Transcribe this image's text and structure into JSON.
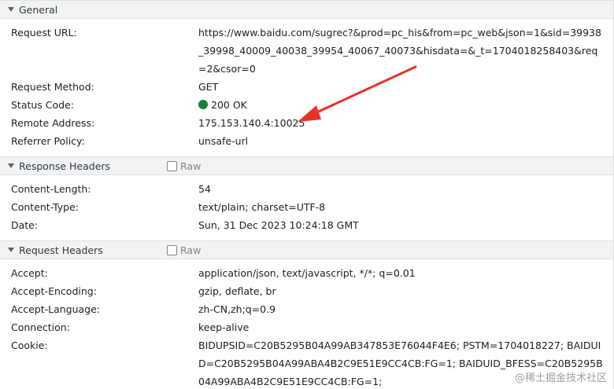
{
  "general": {
    "title": "General",
    "rows": [
      {
        "key": "Request URL:",
        "value": "https://www.baidu.com/sugrec?&prod=pc_his&from=pc_web&json=1&sid=39938_39998_40009_40038_39954_40067_40073&hisdata=&_t=1704018258403&req=2&csor=0"
      },
      {
        "key": "Request Method:",
        "value": "GET"
      },
      {
        "key": "Status Code:",
        "value": "200 OK",
        "status_color": "#188038"
      },
      {
        "key": "Remote Address:",
        "value": "175.153.140.4:10025"
      },
      {
        "key": "Referrer Policy:",
        "value": "unsafe-url"
      }
    ]
  },
  "response_headers": {
    "title": "Response Headers",
    "raw_label": "Raw",
    "rows": [
      {
        "key": "Content-Length:",
        "value": "54"
      },
      {
        "key": "Content-Type:",
        "value": "text/plain; charset=UTF-8"
      },
      {
        "key": "Date:",
        "value": "Sun, 31 Dec 2023 10:24:18 GMT"
      }
    ]
  },
  "request_headers": {
    "title": "Request Headers",
    "raw_label": "Raw",
    "rows": [
      {
        "key": "Accept:",
        "value": "application/json, text/javascript, */*; q=0.01"
      },
      {
        "key": "Accept-Encoding:",
        "value": "gzip, deflate, br"
      },
      {
        "key": "Accept-Language:",
        "value": "zh-CN,zh;q=0.9"
      },
      {
        "key": "Connection:",
        "value": "keep-alive"
      },
      {
        "key": "Cookie:",
        "value": "BIDUPSID=C20B5295B04A99AB347853E76044F4E6; PSTM=1704018227; BAIDUID=C20B5295B04A99ABA4B2C9E51E9CC4CB:FG=1; BAIDUID_BFESS=C20B5295B04A99ABA4B2C9E51E9CC4CB:FG=1;"
      }
    ]
  },
  "annotation": {
    "arrow_color": "#e8312a"
  },
  "watermark": "@稀土掘金技术社区"
}
